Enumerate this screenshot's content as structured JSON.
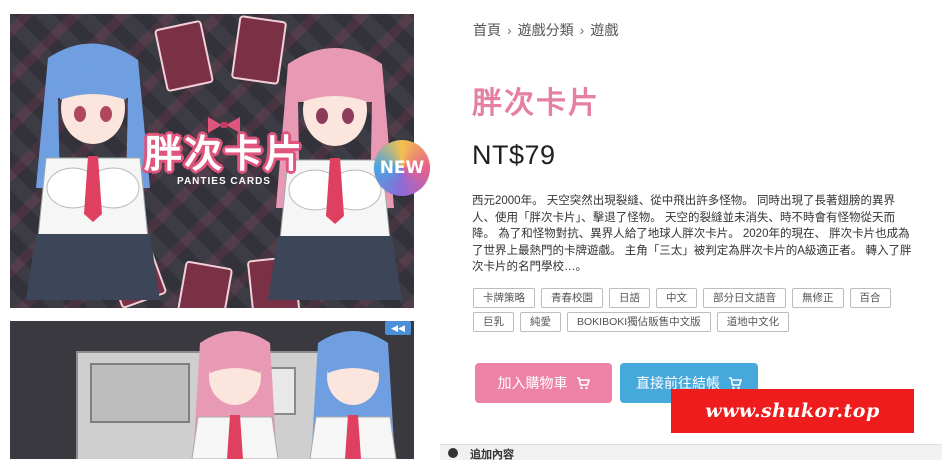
{
  "hero": {
    "logo_text": "胖次卡片",
    "logo_subtitle": "PANTIES CARDS",
    "badge_text": "NEW"
  },
  "gallery": {
    "nav_icon": "rewind-icon",
    "nav_glyph": "◀◀"
  },
  "breadcrumb": {
    "items": [
      "首頁",
      "遊戲分類",
      "遊戲"
    ],
    "separator": "›"
  },
  "product": {
    "title": "胖次卡片",
    "price": "NT$79",
    "description": "西元2000年。 天空突然出現裂縫、從中飛出許多怪物。 同時出現了長著翅膀的異界人、使用「胖次卡片」、擊退了怪物。 天空的裂縫並未消失、時不時會有怪物從天而降。 為了和怪物對抗、異界人給了地球人胖次卡片。 2020年的現在、 胖次卡片也成為了世界上最熱門的卡牌遊戲。 主角「三太」被判定為胖次卡片的A級適正者。 轉入了胖次卡片的名門學校…。",
    "tags": [
      "卡牌策略",
      "青春校園",
      "日語",
      "中文",
      "部分日文語音",
      "無修正",
      "百合",
      "巨乳",
      "純愛",
      "BOKIBOKI獨佔販售中文版",
      "道地中文化"
    ]
  },
  "actions": {
    "add_to_cart": "加入購物車",
    "checkout": "直接前往結帳"
  },
  "watermark": "www.shukor.top",
  "more": {
    "label": "追加內容"
  },
  "colors": {
    "title_pink": "#e57fa3",
    "cart_button": "#ec82a6",
    "checkout_button": "#45a9dc",
    "watermark_red": "#ee1c1c"
  }
}
